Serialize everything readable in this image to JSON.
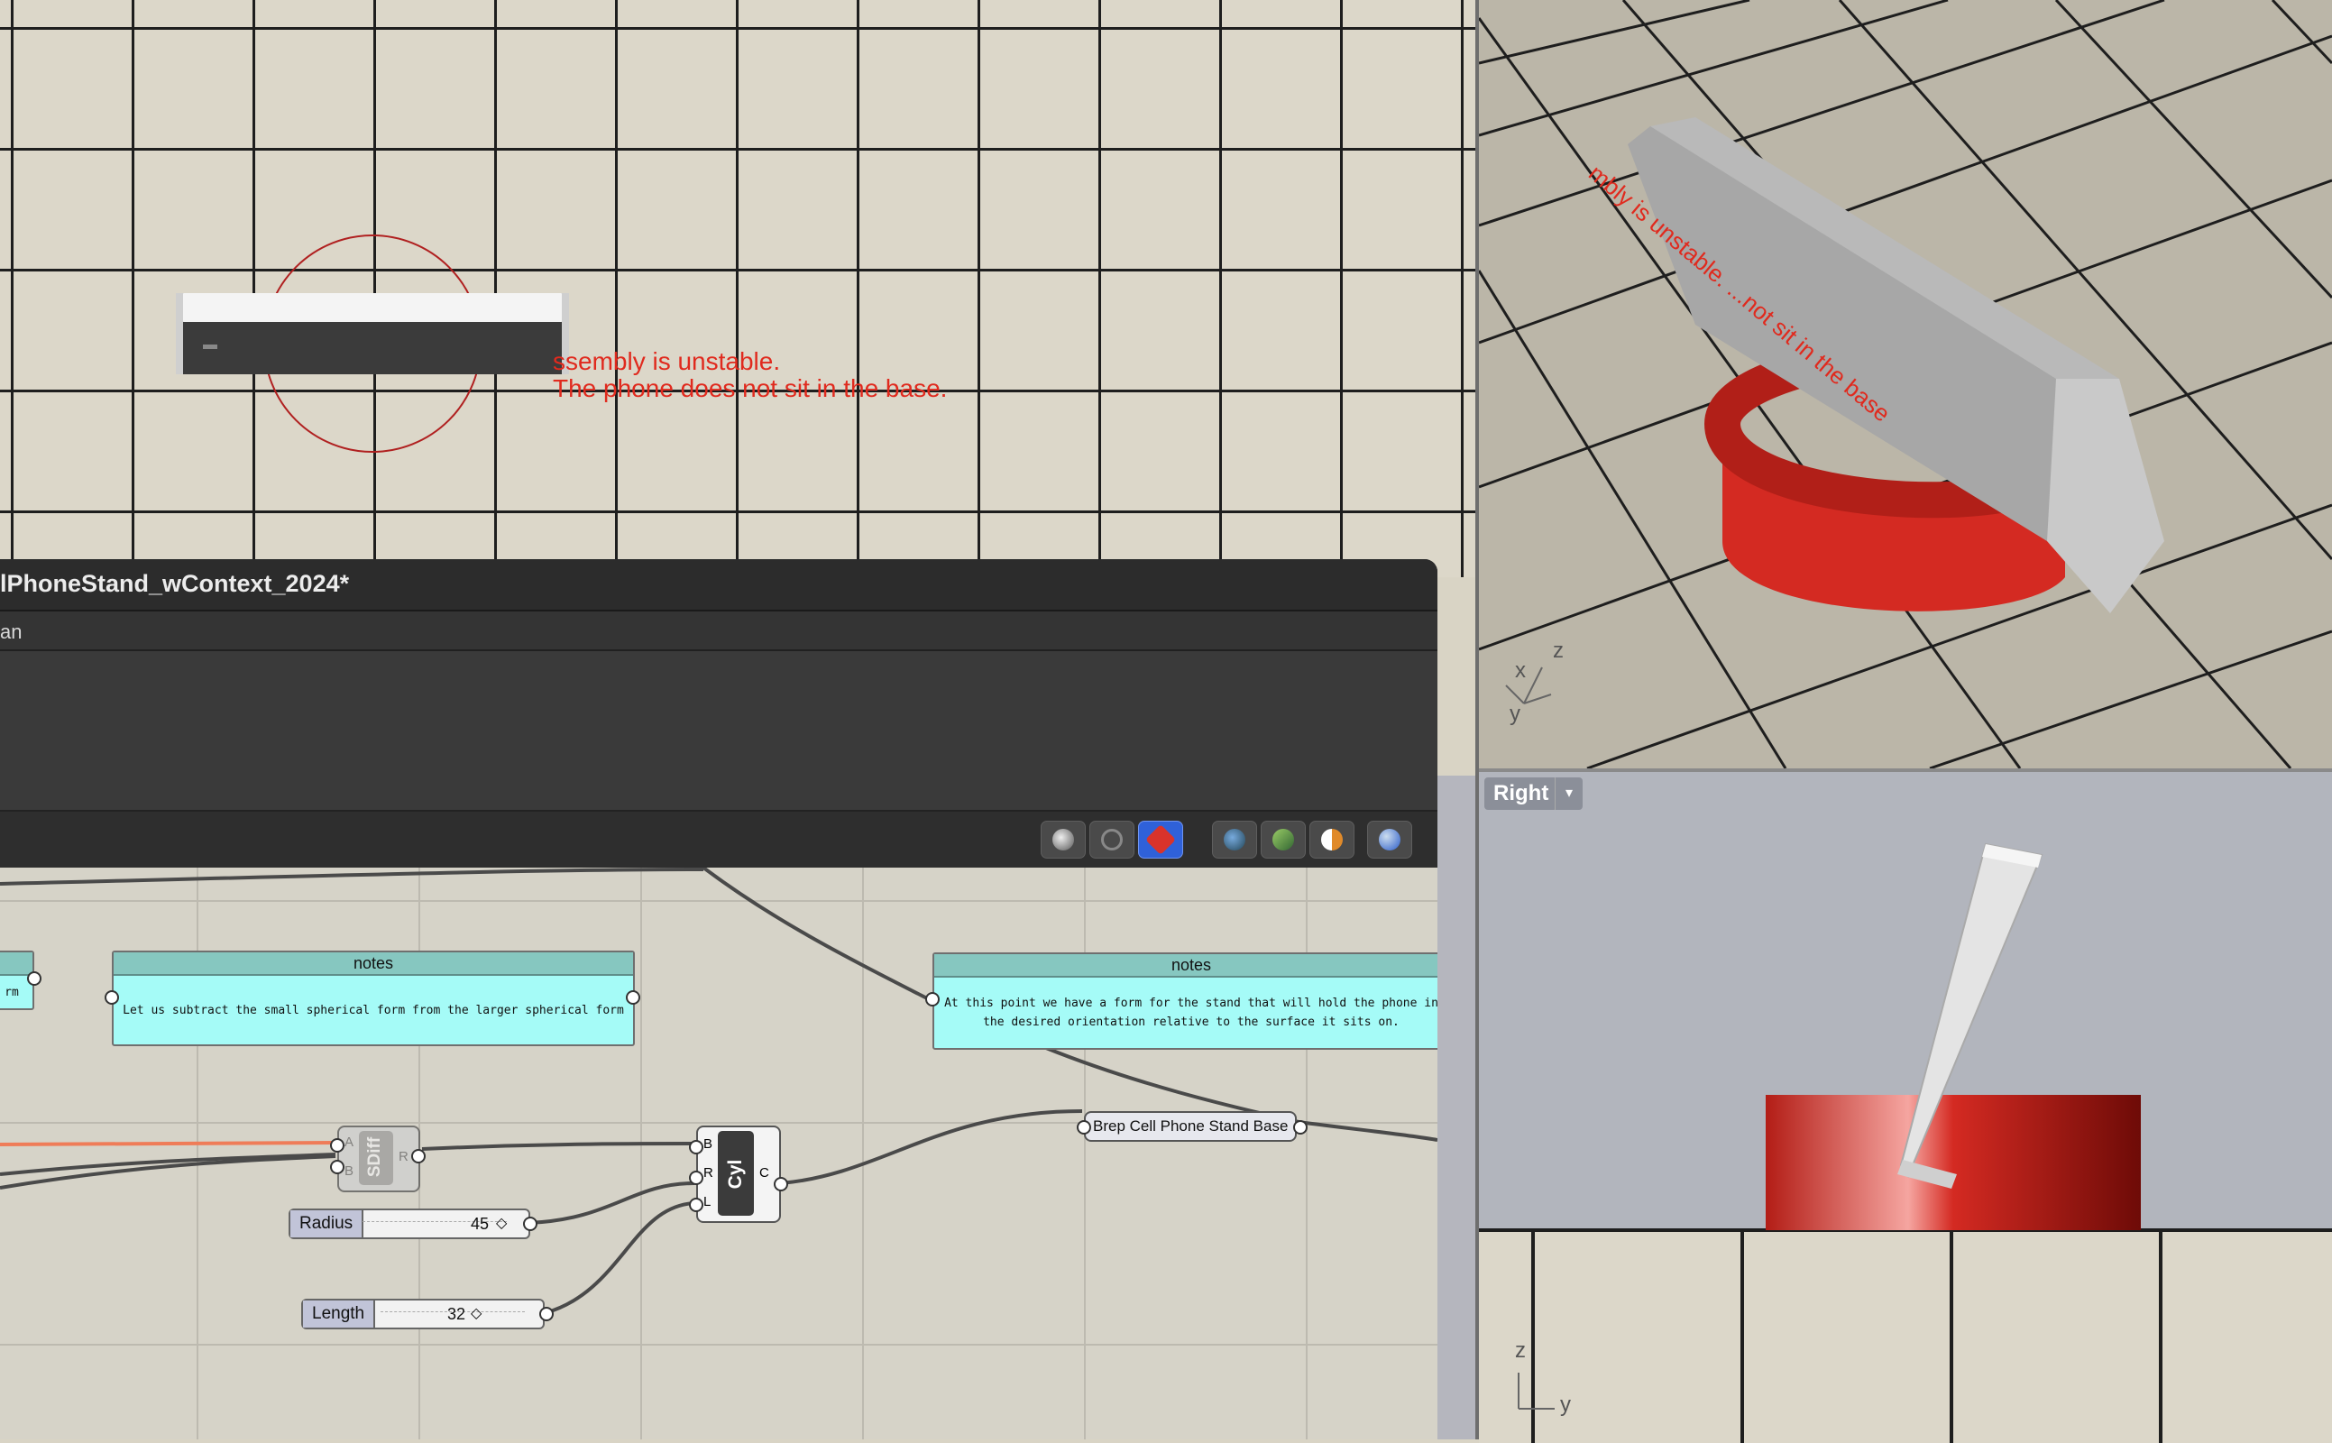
{
  "top_viewport": {
    "warning_line1": "ssembly is unstable.",
    "warning_line2": "The phone does not sit in the base."
  },
  "grasshopper": {
    "title": "lPhoneStand_wContext_2024*",
    "menu_label": "an",
    "toolbar_buttons": [
      "shaded-preview-icon",
      "no-preview-icon",
      "selected-preview-icon",
      "document-preview-icon",
      "mesh-preview-icon",
      "material-preview-icon",
      "sphere-preview-icon"
    ],
    "notes_left": {
      "header": "notes",
      "body": "Let us subtract the small spherical form from the larger spherical form"
    },
    "notes_partial": {
      "body": "rm"
    },
    "notes_right": {
      "header": "notes",
      "body": "At this point we have a form for the stand that will hold the phone in the desired orientation relative to the surface it sits on."
    },
    "sdiff": {
      "label": "SDiff",
      "in_a": "A",
      "in_b": "B",
      "out_r": "R"
    },
    "cyl": {
      "label": "Cyl",
      "in_b": "B",
      "in_r": "R",
      "in_l": "L",
      "out_c": "C"
    },
    "radius_slider": {
      "label": "Radius",
      "value": "45"
    },
    "length_slider": {
      "label": "Length",
      "value": "32"
    },
    "brep_param": {
      "label": "Brep Cell Phone Stand Base"
    }
  },
  "persp_viewport": {
    "text": "mbly is unstable. ...not sit in the base",
    "axis_z": "z",
    "axis_x": "x",
    "axis_y": "y"
  },
  "right_viewport": {
    "label": "Right",
    "dropdown": "▾",
    "axis_z": "z",
    "axis_y": "y"
  },
  "colors": {
    "warning": "#e02a1e",
    "base_red": "#d42a22",
    "note_fill": "#a5fbf7",
    "toolbar_active": "#2f61d9"
  }
}
